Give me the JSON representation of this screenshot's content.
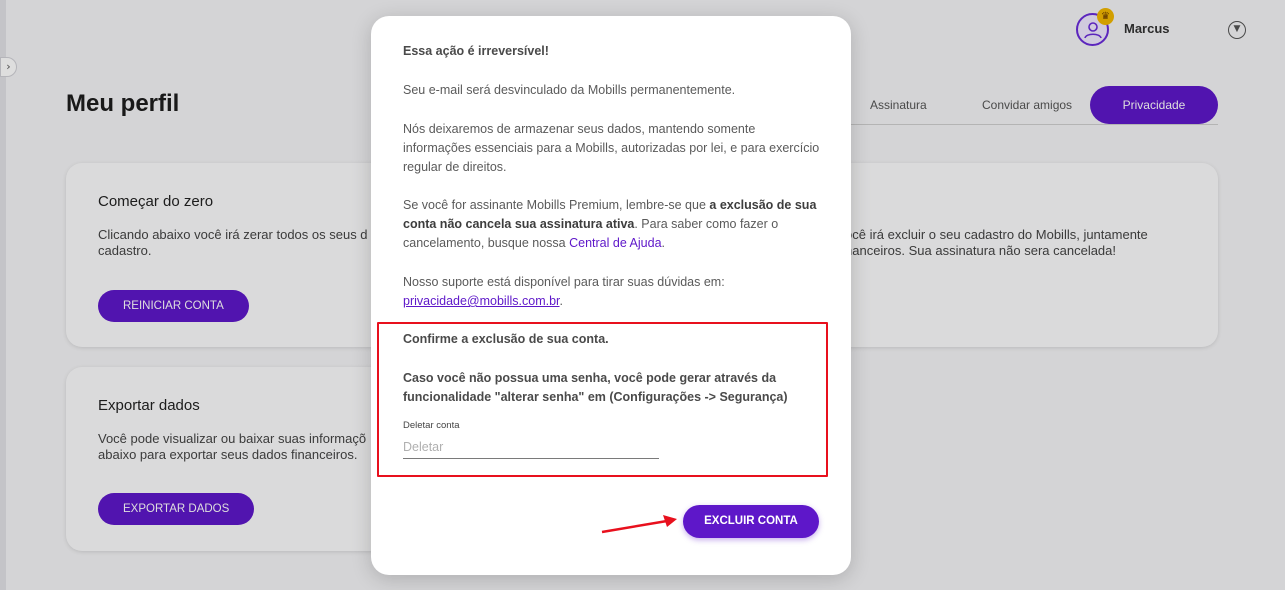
{
  "user": {
    "name": "Marcus"
  },
  "page": {
    "title": "Meu perfil"
  },
  "tabs": {
    "items": [
      "Assinatura",
      "Convidar amigos"
    ],
    "active": "Privacidade"
  },
  "cards": {
    "restart": {
      "title": "Começar do zero",
      "text": "Clicando abaixo você irá zerar todos os seus d cadastro.",
      "right_text": "ocê irá excluir o seu cadastro do Mobills, juntamente nanceiros. Sua assinatura não sera cancelada!",
      "button": "REINICIAR CONTA"
    },
    "export": {
      "title": "Exportar dados",
      "text": "Você pode visualizar ou baixar suas informaçõ abaixo para exportar seus dados financeiros.",
      "button": "EXPORTAR DADOS"
    }
  },
  "modal": {
    "heading": "Essa ação é irreversível!",
    "p1": "Seu e-mail será desvinculado da Mobills permanentemente.",
    "p2": "Nós deixaremos de armazenar seus dados, mantendo somente informações essenciais para a Mobills, autorizadas por lei, e para exercício regular de direitos.",
    "p3_start": "Se você for assinante Mobills Premium, lembre-se que ",
    "p3_bold": "a exclusão de sua conta não cancela sua assinatura ativa",
    "p3_mid": ". Para saber como fazer o cancelamento, busque nossa ",
    "p3_link": "Central de Ajuda",
    "p3_end": ".",
    "p4_start": "Nosso suporte está disponível para tirar suas dúvidas em: ",
    "p4_email": "privacidade@mobills.com.br",
    "p4_end": ".",
    "confirm_title": "Confirme a exclusão de sua conta.",
    "confirm_note": "Caso você não possua uma senha, você pode gerar através da funcionalidade \"alterar senha\" em (Configurações -> Segurança)",
    "field_label": "Deletar conta",
    "field_placeholder": "Deletar",
    "field_value": "",
    "delete_button": "EXCLUIR CONTA"
  },
  "colors": {
    "brand": "#5e17c9",
    "highlight": "#e8101d"
  }
}
